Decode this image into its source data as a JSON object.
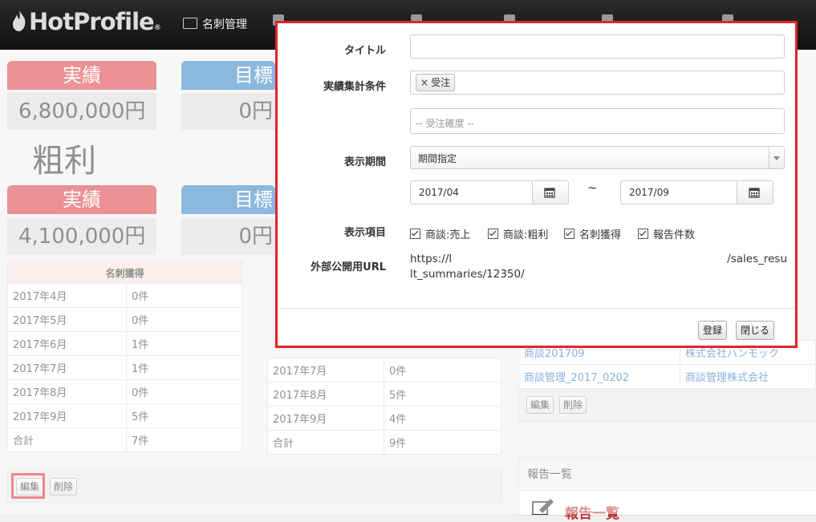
{
  "app": {
    "logo": "HotProfile"
  },
  "nav": {
    "items": [
      "名刺管理"
    ]
  },
  "left_panel": {
    "row1": {
      "actual_label": "実績",
      "actual_value": "6,800,000円",
      "target_label": "目標",
      "target_value": "0円"
    },
    "gross_title": "粗利",
    "row2": {
      "actual_label": "実績",
      "actual_value": "4,100,000円",
      "target_label": "目標",
      "target_value": "0円"
    },
    "table1": {
      "header": "名刺獲得",
      "rows": [
        [
          "2017年4月",
          "0件"
        ],
        [
          "2017年5月",
          "0件"
        ],
        [
          "2017年6月",
          "1件"
        ],
        [
          "2017年7月",
          "1件"
        ],
        [
          "2017年8月",
          "0件"
        ],
        [
          "2017年9月",
          "5件"
        ],
        [
          "合計",
          "7件"
        ]
      ]
    },
    "table2": {
      "rows": [
        [
          "2017年7月",
          "0件"
        ],
        [
          "2017年8月",
          "5件"
        ],
        [
          "2017年9月",
          "4件"
        ],
        [
          "合計",
          "9件"
        ]
      ]
    },
    "edit_button": "編集",
    "delete_button": "削除"
  },
  "right_panel": {
    "deals": [
      {
        "name": "商談201709",
        "company": "株式会社ハンモック"
      },
      {
        "name": "商談管理_2017_0202",
        "company": "商談管理株式会社"
      }
    ],
    "edit_button": "編集",
    "delete_button": "削除",
    "reports_header": "報告一覧",
    "reports_title": "報告一覧"
  },
  "modal": {
    "title_label": "タイトル",
    "title_value": "",
    "condition_label": "実績集計条件",
    "condition_tag": "受注",
    "condition2_placeholder": "-- 受注確度 --",
    "period_label": "表示期間",
    "period_select": "期間指定",
    "date_from": "2017/04",
    "date_sep": "~",
    "date_to": "2017/09",
    "items_label": "表示項目",
    "items": [
      "商談:売上",
      "商談:粗利",
      "名刺獲得",
      "報告件数"
    ],
    "url_label": "外部公開用URL",
    "url_line1_start": "https://l",
    "url_line1_end": "/sales_resu",
    "url_line2": "lt_summaries/12350/",
    "register_button": "登録",
    "close_button": "閉じる"
  }
}
